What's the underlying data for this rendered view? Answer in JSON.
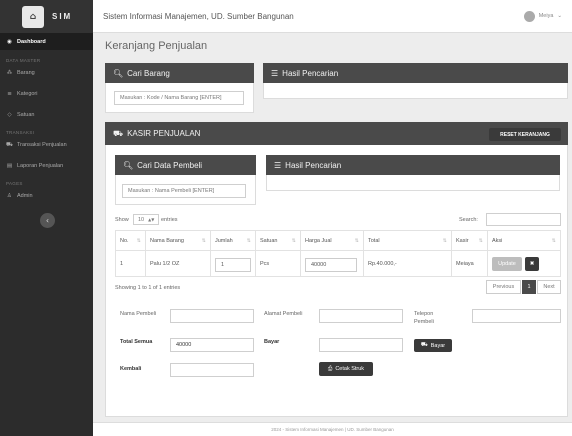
{
  "app": {
    "logo_glyph": "⌂",
    "logo_text": "SIM"
  },
  "header": {
    "title": "Sistem Informasi Manajemen, UD. Sumber Bangunan",
    "user_name": "Meiya",
    "user_caret": "⌄"
  },
  "sidebar": {
    "dashboard": "Dashboard",
    "section_master": "DATA MASTER",
    "barang": "Barang",
    "kategori": "Kategori",
    "satuan": "Satuan",
    "section_transaksi": "TRANSAKSI",
    "transaksi_penjualan": "Transaksi Penjualan",
    "laporan_penjualan": "Laporan Penjualan",
    "section_pages": "PAGES",
    "admin": "Admin",
    "toggle_glyph": "‹"
  },
  "page": {
    "title": "Keranjang Penjualan"
  },
  "cari_barang": {
    "heading": "Cari Barang",
    "placeholder": "Masukan : Kode / Nama Barang [ENTER]"
  },
  "hasil_pencarian_1": {
    "heading": "Hasil Pencarian"
  },
  "kasir": {
    "heading": "KASIR PENJUALAN",
    "reset_label": "RESET KERANJANG"
  },
  "cari_pembeli": {
    "heading": "Cari Data Pembeli",
    "placeholder": "Masukan : Nama Pembeli [ENTER]"
  },
  "hasil_pencarian_2": {
    "heading": "Hasil Pencarian"
  },
  "table_controls": {
    "show": "Show",
    "entries_value": "10",
    "entries": "entries",
    "search": "Search:"
  },
  "table": {
    "columns": [
      "No.",
      "Nama Barang",
      "Jumlah",
      "Satuan",
      "Harga Jual",
      "Total",
      "Kasir",
      "Aksi"
    ],
    "rows": [
      {
        "no": "1",
        "nama": "Palu 1/2 OZ",
        "jumlah": "1",
        "satuan": "Pcs",
        "harga": "40000",
        "total": "Rp.40.000,-",
        "kasir": "Meiaya",
        "update_label": "Update",
        "delete_glyph": "✖"
      }
    ]
  },
  "pagination": {
    "info": "Showing 1 to 1 of 1 entries",
    "previous": "Previous",
    "page": "1",
    "next": "Next"
  },
  "form": {
    "nama_pembeli": "Nama Pembeli",
    "alamat_pembeli": "Alamat Pembeli",
    "telepon_pembeli": "Telepon Pembeli",
    "total_semua": "Total Semua",
    "total_value": "40000",
    "bayar": "Bayar",
    "bayar_button": "Bayar",
    "kembali": "Kembali",
    "cetak_button": "Cetak Struk"
  },
  "footer": {
    "text": "2024 - Sistem Informasi Manajemen | UD. Sumber Bangunan"
  }
}
